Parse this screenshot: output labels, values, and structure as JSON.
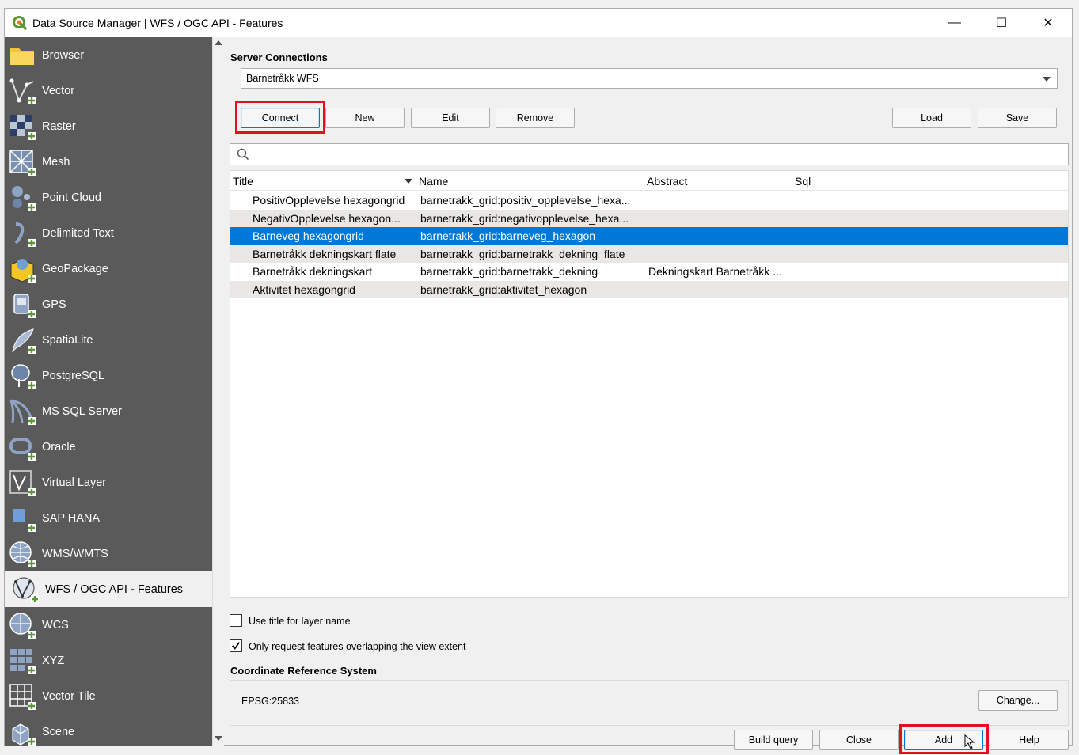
{
  "window": {
    "title": "Data Source Manager | WFS / OGC API - Features",
    "minimize": "—",
    "maximize": "☐",
    "close": "✕"
  },
  "sidebar": {
    "items": [
      {
        "label": "Browser",
        "icon": "folder-icon"
      },
      {
        "label": "Vector",
        "icon": "vector-icon"
      },
      {
        "label": "Raster",
        "icon": "raster-icon"
      },
      {
        "label": "Mesh",
        "icon": "mesh-icon"
      },
      {
        "label": "Point Cloud",
        "icon": "point-cloud-icon"
      },
      {
        "label": "Delimited Text",
        "icon": "delimited-text-icon"
      },
      {
        "label": "GeoPackage",
        "icon": "geopackage-icon"
      },
      {
        "label": "GPS",
        "icon": "gps-icon"
      },
      {
        "label": "SpatiaLite",
        "icon": "spatialite-icon"
      },
      {
        "label": "PostgreSQL",
        "icon": "postgresql-icon"
      },
      {
        "label": "MS SQL Server",
        "icon": "mssql-icon"
      },
      {
        "label": "Oracle",
        "icon": "oracle-icon"
      },
      {
        "label": "Virtual Layer",
        "icon": "virtual-layer-icon"
      },
      {
        "label": "SAP HANA",
        "icon": "sap-hana-icon"
      },
      {
        "label": "WMS/WMTS",
        "icon": "wms-icon"
      },
      {
        "label": "WFS / OGC API - Features",
        "icon": "wfs-icon",
        "active": true
      },
      {
        "label": "WCS",
        "icon": "wcs-icon"
      },
      {
        "label": "XYZ",
        "icon": "xyz-icon"
      },
      {
        "label": "Vector Tile",
        "icon": "vector-tile-icon"
      },
      {
        "label": "Scene",
        "icon": "scene-icon"
      }
    ]
  },
  "server": {
    "section_label": "Server Connections",
    "selected_connection": "Barnetråkk WFS",
    "connect": "Connect",
    "new": "New",
    "edit": "Edit",
    "remove": "Remove",
    "load": "Load",
    "save": "Save"
  },
  "search": {
    "placeholder": ""
  },
  "table": {
    "columns": [
      "Title",
      "Name",
      "Abstract",
      "Sql"
    ],
    "rows": [
      {
        "title": "PositivOpplevelse hexagongrid",
        "name": "barnetrakk_grid:positiv_opplevelse_hexa...",
        "abstract": "",
        "sql": ""
      },
      {
        "title": "NegativOpplevelse hexagon...",
        "name": "barnetrakk_grid:negativopplevelse_hexa...",
        "abstract": "",
        "sql": ""
      },
      {
        "title": "Barneveg hexagongrid",
        "name": "barnetrakk_grid:barneveg_hexagon",
        "abstract": "",
        "sql": "",
        "selected": true
      },
      {
        "title": "Barnetråkk dekningskart flate",
        "name": "barnetrakk_grid:barnetrakk_dekning_flate",
        "abstract": "",
        "sql": ""
      },
      {
        "title": "Barnetråkk dekningskart",
        "name": "barnetrakk_grid:barnetrakk_dekning",
        "abstract": "Dekningskart Barnetråkk ...",
        "sql": ""
      },
      {
        "title": "Aktivitet hexagongrid",
        "name": "barnetrakk_grid:aktivitet_hexagon",
        "abstract": "",
        "sql": ""
      }
    ]
  },
  "options": {
    "use_title": {
      "label": "Use title for layer name",
      "checked": false
    },
    "only_request": {
      "label": "Only request features overlapping the view extent",
      "checked": true
    }
  },
  "crs": {
    "section_label": "Coordinate Reference System",
    "value": "EPSG:25833",
    "change": "Change..."
  },
  "footer": {
    "build_query": "Build query",
    "close": "Close",
    "add": "Add",
    "help": "Help"
  },
  "colors": {
    "sidebar_bg": "#5a5a5a",
    "selection": "#0078d7",
    "highlight_red": "#e0101f",
    "qgis_green": "#589632"
  }
}
